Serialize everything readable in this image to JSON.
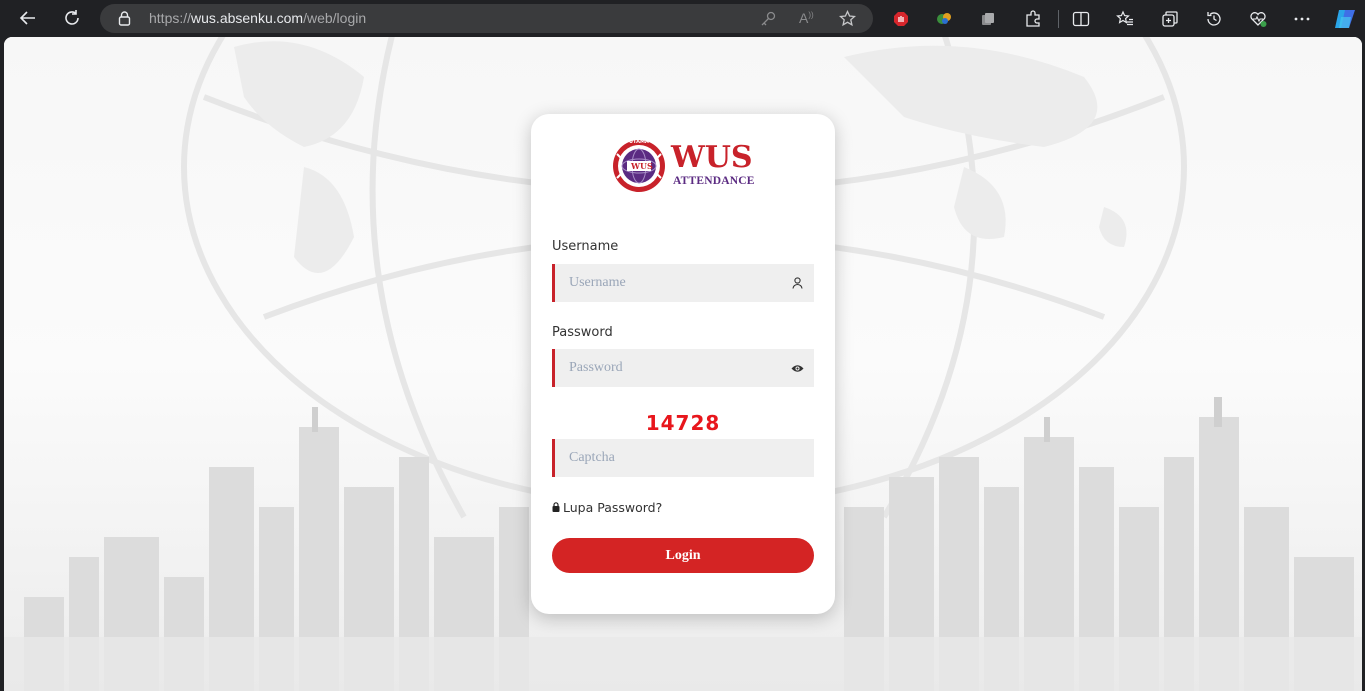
{
  "browser": {
    "url_prefix": "https://",
    "url_host": "wus.absenku.com",
    "url_path": "/web/login"
  },
  "logo": {
    "title": "WUS",
    "subtitle": "ATTENDANCE",
    "seal_top": "UTAMA",
    "seal_center": "WUS"
  },
  "form": {
    "username_label": "Username",
    "username_placeholder": "Username",
    "password_label": "Password",
    "password_placeholder": "Password",
    "captcha_code": "14728",
    "captcha_placeholder": "Captcha",
    "forgot_label": "Lupa Password?",
    "login_label": "Login"
  },
  "colors": {
    "accent": "#c8222a",
    "button": "#d42424",
    "captcha": "#e8161c",
    "brand_purple": "#5b2b82"
  }
}
